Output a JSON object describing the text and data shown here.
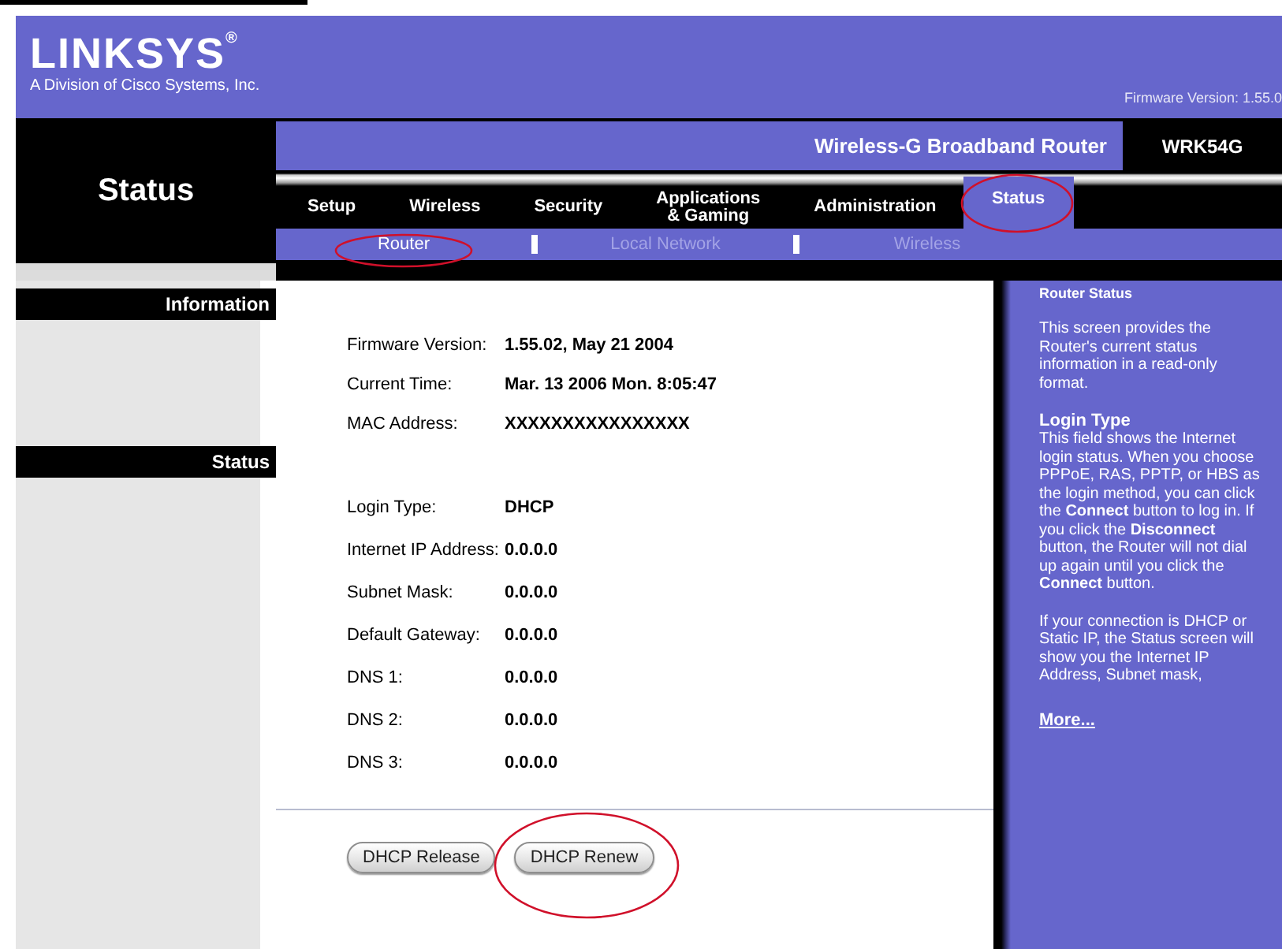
{
  "header": {
    "logo": "LINKSYS$^{®}$",
    "tagline": "A Division of Cisco Systems, Inc.",
    "firmware": "Firmware Version: 1.55.0"
  },
  "nav": {
    "page_title": "Status",
    "product": "Wireless-G Broadband Router",
    "model": "WRK54G",
    "tabs": [
      {
        "label": "Setup",
        "selected": false,
        "annotated": false
      },
      {
        "label": "Wireless",
        "selected": false,
        "annotated": false
      },
      {
        "label": "Security",
        "selected": false,
        "annotated": false
      },
      {
        "label": "Applications\n& Gaming",
        "selected": false,
        "annotated": false
      },
      {
        "label": "Administration",
        "selected": false,
        "annotated": false
      },
      {
        "label": "Status",
        "selected": true,
        "annotated": true
      }
    ],
    "subtabs": [
      {
        "label": "Router",
        "selected": true,
        "annotated": true
      },
      {
        "label": "Local Network",
        "selected": false,
        "annotated": false
      },
      {
        "label": "Wireless",
        "selected": false,
        "annotated": false
      }
    ]
  },
  "sidebar": {
    "sections": [
      "Information",
      "Status"
    ]
  },
  "information": [
    {
      "label": "Firmware Version:",
      "value": "1.55.02, May 21 2004"
    },
    {
      "label": "Current Time:",
      "value": "Mar. 13 2006 Mon. 8:05:47"
    },
    {
      "label": "MAC Address:",
      "value": "XXXXXXXXXXXXXXXX"
    }
  ],
  "status": [
    {
      "label": "Login Type:",
      "value": "DHCP"
    },
    {
      "label": "Internet IP Address:",
      "value": "0.0.0.0"
    },
    {
      "label": "Subnet Mask:",
      "value": "0.0.0.0"
    },
    {
      "label": "Default Gateway:",
      "value": "0.0.0.0"
    },
    {
      "label": "DNS 1:",
      "value": "0.0.0.0"
    },
    {
      "label": "DNS 2:",
      "value": "0.0.0.0"
    },
    {
      "label": "DNS 3:",
      "value": "0.0.0.0"
    }
  ],
  "buttons": [
    {
      "label": "DHCP Release",
      "annotated": false
    },
    {
      "label": "DHCP Renew",
      "annotated": true
    }
  ],
  "help": {
    "title": "Router Status",
    "paragraphs": [
      {
        "text": "This screen provides the Router's current status information in a read-only format."
      },
      {
        "heading": "Login Type",
        "text": "This field shows the Internet login status. When you choose PPPoE, RAS, PPTP, or HBS as the login method, you can click the **Connect** button to log in. If you click the **Disconnect** button, the Router will not dial up again until you click the **Connect** button."
      },
      {
        "text": "If your connection is DHCP or Static IP, the Status screen will show you the Internet IP Address, Subnet mask,"
      }
    ],
    "more": "More..."
  }
}
